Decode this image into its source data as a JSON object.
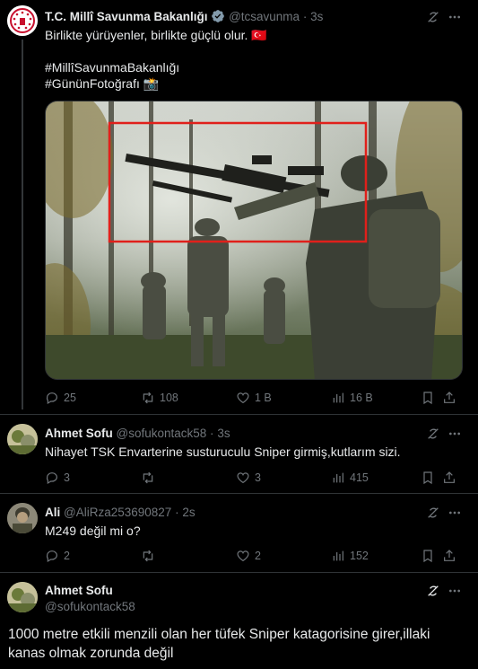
{
  "main_tweet": {
    "name": "T.C. Millî Savunma Bakanlığı",
    "handle": "@tcsavunma",
    "time": "3s",
    "text": "Birlikte yürüyenler, birlikte güçlü olur.",
    "flag": "🇹🇷",
    "hashtags": [
      "#MillîSavunmaBakanlığı",
      "#GününFotoğrafı 📸"
    ],
    "stats": {
      "replies": "25",
      "retweets": "108",
      "likes": "1 B",
      "views": "16 B"
    }
  },
  "replies": [
    {
      "name": "Ahmet Sofu",
      "handle": "@sofukontack58",
      "time": "3s",
      "text": "Nihayet TSK Envarterine susturuculu Sniper girmiş,kutlarım sizi.",
      "stats": {
        "replies": "3",
        "retweets": "",
        "likes": "3",
        "views": "415"
      }
    },
    {
      "name": "Ali",
      "handle": "@AliRza253690827",
      "time": "2s",
      "text": "M249 değil mi o?",
      "stats": {
        "replies": "2",
        "retweets": "",
        "likes": "2",
        "views": "152"
      }
    }
  ],
  "focused_reply": {
    "name": "Ahmet Sofu",
    "handle": "@sofukontack58",
    "text": "1000 metre etkili menzili olan her tüfek Sniper katagorisine girer,illaki kanas olmak zorunda değil"
  },
  "colors": {
    "background": "#000000",
    "muted": "#71767b",
    "link": "#1d9bf0",
    "verified": "#829aab",
    "highlight_box": "#e0201b"
  }
}
